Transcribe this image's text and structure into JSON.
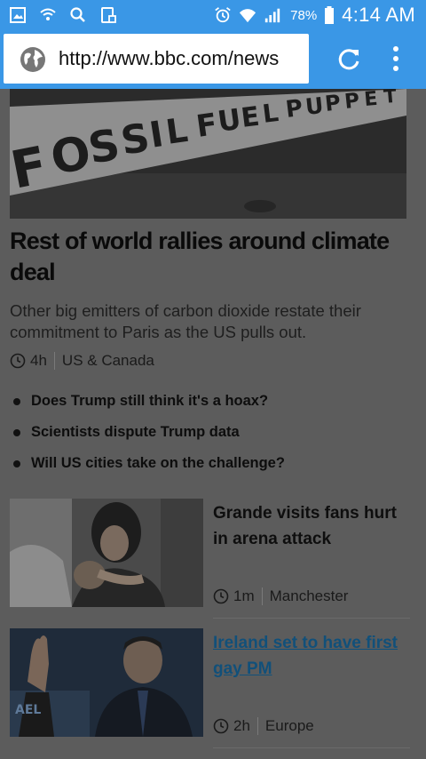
{
  "status_bar": {
    "battery_percent": "78%",
    "time": "4:14 AM",
    "bg_color": "#3a97e6",
    "left_icons": [
      "image-icon",
      "wifi-notification-icon",
      "search-icon",
      "screenshot-icon"
    ],
    "right_icons": [
      "alarm-icon",
      "wifi-icon",
      "signal-icon",
      "battery-icon"
    ]
  },
  "browser": {
    "url": "http://www.bbc.com/news",
    "icons": [
      "globe-icon",
      "reload-icon",
      "overflow-menu-icon"
    ]
  },
  "lead_story": {
    "headline": "Rest of world rallies around climate deal",
    "summary": "Other big emitters of carbon dioxide restate their commitment to Paris as the US pulls out.",
    "age": "4h",
    "section": "US & Canada",
    "image_text": "FOSSIL FUEL PUPPET",
    "related": [
      "Does Trump still think it's a hoax?",
      "Scientists dispute Trump data",
      "Will US cities take on the challenge?"
    ]
  },
  "stories": [
    {
      "title": "Grande visits fans hurt in arena attack",
      "age": "1m",
      "section": "Manchester",
      "visited": false
    },
    {
      "title": "Ireland set to have first gay PM",
      "age": "2h",
      "section": "Europe",
      "visited": true
    }
  ]
}
